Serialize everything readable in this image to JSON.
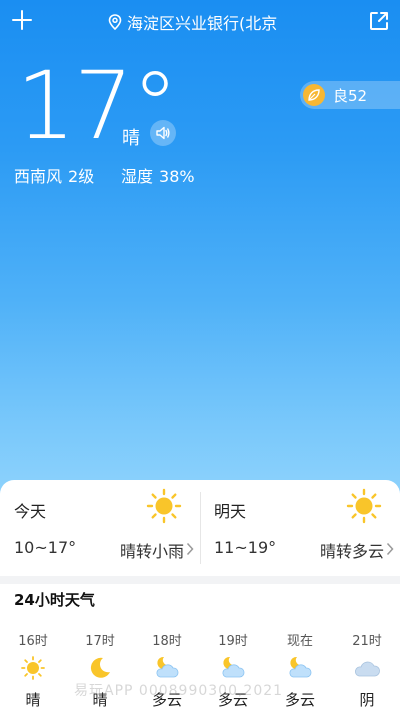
{
  "header": {
    "location": "海淀区兴业银行(北京"
  },
  "current": {
    "temperature": "17°",
    "condition": "晴",
    "wind_label": "西南风",
    "wind_value": "2级",
    "humidity_label": "湿度",
    "humidity_value": "38%",
    "aqi": "良52"
  },
  "forecast": {
    "today": {
      "day": "今天",
      "range": "10~17°",
      "desc": "晴转小雨",
      "icon": "sun-icon"
    },
    "tomorrow": {
      "day": "明天",
      "range": "11~19°",
      "desc": "晴转多云",
      "icon": "sun-icon"
    }
  },
  "hourly": {
    "title": "24小时天气",
    "items": [
      {
        "time": "16时",
        "desc": "晴",
        "icon": "sun-icon"
      },
      {
        "time": "17时",
        "desc": "晴",
        "icon": "moon-icon"
      },
      {
        "time": "18时",
        "desc": "多云",
        "icon": "partly-cloudy-night-icon"
      },
      {
        "time": "19时",
        "desc": "多云",
        "icon": "partly-cloudy-night-icon"
      },
      {
        "time": "现在",
        "desc": "多云",
        "icon": "partly-cloudy-night-icon"
      },
      {
        "time": "21时",
        "desc": "阴",
        "icon": "cloud-icon"
      }
    ]
  },
  "watermark": "易玩APP 0008990300,2021",
  "colors": {
    "sky_top": "#1a8ef2",
    "sky_bottom": "#8fd3fc",
    "sun": "#f9c52a",
    "aqi_badge": "#f7b733"
  }
}
